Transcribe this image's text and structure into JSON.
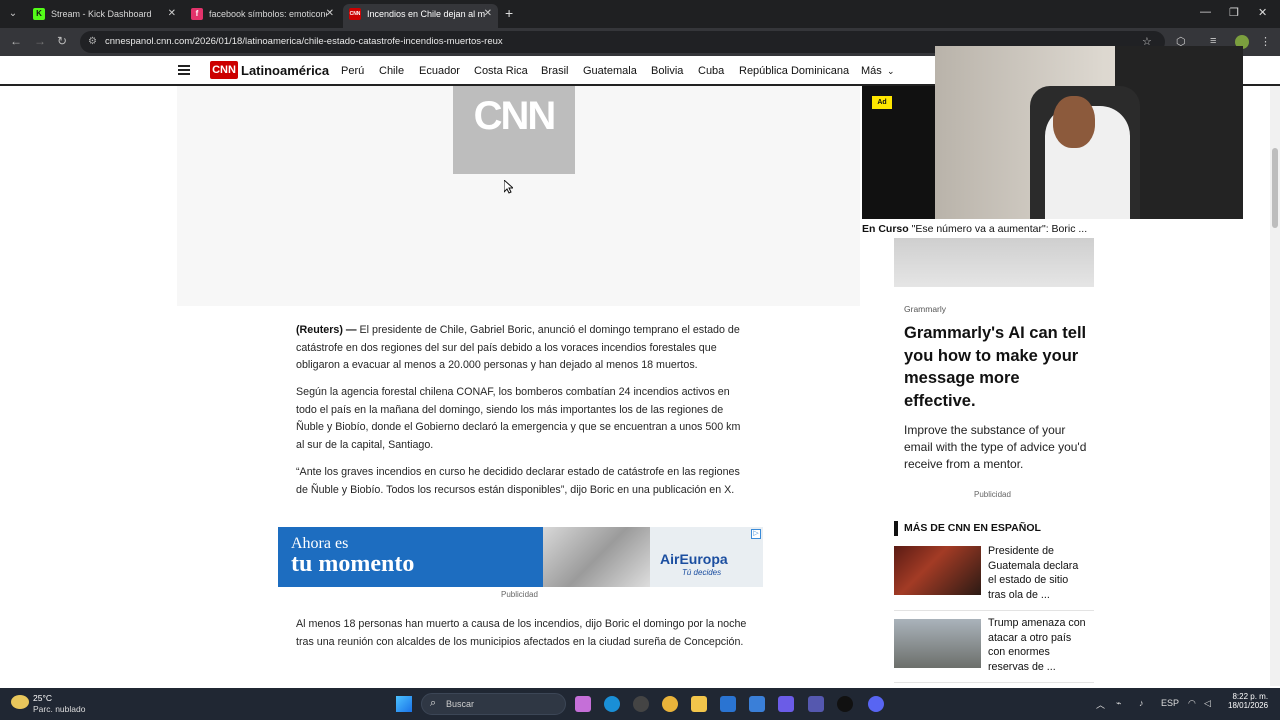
{
  "browser": {
    "tabs": [
      {
        "title": "Stream - Kick Dashboard",
        "favicon": "K"
      },
      {
        "title": "facebook símbolos: emoticone",
        "favicon": "f"
      },
      {
        "title": "Incendios en Chile dejan al me",
        "favicon": "CNN"
      }
    ],
    "url": "cnnespanol.cnn.com/2026/01/18/latinoamerica/chile-estado-catastrofe-incendios-muertos-reux"
  },
  "site": {
    "logo_text": "CNN",
    "section": "Latinoamérica",
    "nav": [
      "Perú",
      "Chile",
      "Ecuador",
      "Costa Rica",
      "Brasil",
      "Guatemala",
      "Bolivia",
      "Cuba",
      "República Dominicana",
      "Más"
    ]
  },
  "media": {
    "placeholder_logo": "CNN"
  },
  "article": {
    "p1_source": "(Reuters) —",
    "p1": " El presidente de Chile, Gabriel Boric, anunció el domingo temprano el estado de catástrofe en dos regiones del sur del país debido a los voraces incendios forestales que obligaron a evacuar al menos a 20.000 personas y han dejado al menos 18 muertos.",
    "p2": "Según la agencia forestal chilena CONAF, los bomberos combatían 24 incendios activos en todo el país en la mañana del domingo, siendo los más importantes los de las regiones de Ñuble y Biobío, donde el Gobierno declaró la emergencia y que se encuentran a unos 500 km al sur de la capital, Santiago.",
    "p3": "“Ante los graves incendios en curso he decidido declarar estado de catástrofe en las regiones de Ñuble y Biobío. Todos los recursos están disponibles”, dijo Boric en una publicación en X.",
    "p4": "Al menos 18 personas han muerto a causa de los incendios, dijo Boric el domingo por la noche tras una reunión con alcaldes de los municipios afectados en la ciudad sureña de Concepción."
  },
  "ad_banner": {
    "line1": "Ahora es",
    "line2": "tu momento",
    "brand": "AirEuropa",
    "tagline": "Tú decides",
    "publicidad": "Publicidad"
  },
  "video": {
    "ad_tag": "Ad",
    "en_curso_label": "En Curso",
    "en_curso_text": " \"Ese número va a aumentar\": Boric ..."
  },
  "sidebar_ad": {
    "source": "Grammarly",
    "headline": "Grammarly's AI can tell you how to make your message more effective.",
    "body": "Improve the substance of your email with the type of advice you'd receive from a mentor.",
    "publicidad": "Publicidad"
  },
  "more_cnn": {
    "heading": "MÁS DE CNN EN ESPAÑOL",
    "items": [
      {
        "title": "Presidente de Guatemala declara el estado de sitio tras ola de ..."
      },
      {
        "title": "Trump amenaza con atacar a otro país con enormes reservas de ..."
      }
    ]
  },
  "taskbar": {
    "temperature": "25°C",
    "weather": "Parc. nublado",
    "search_placeholder": "Buscar",
    "language": "ESP",
    "time": "8:22 p. m.",
    "date": "18/01/2026"
  },
  "colors": {
    "cnn_red": "#cc0000",
    "ad_yellow": "#ffe600",
    "airEuropa_blue": "#1d6dc0"
  }
}
